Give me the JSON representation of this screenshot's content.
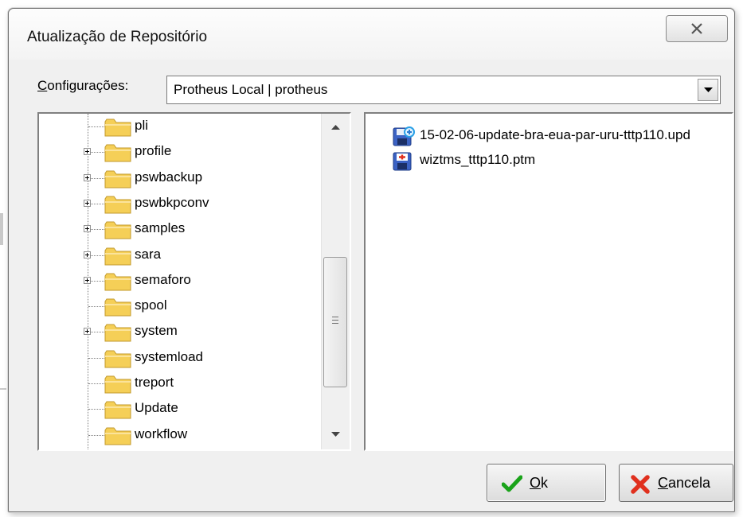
{
  "dialog": {
    "title": "Atualização de Repositório"
  },
  "config": {
    "label_mnemonic": "C",
    "label_rest": "onfigurações:",
    "selected": "Protheus Local | protheus"
  },
  "tree": {
    "items": [
      {
        "label": "pli",
        "expandable": false
      },
      {
        "label": "profile",
        "expandable": true
      },
      {
        "label": "pswbackup",
        "expandable": true
      },
      {
        "label": "pswbkpconv",
        "expandable": true
      },
      {
        "label": "samples",
        "expandable": true
      },
      {
        "label": "sara",
        "expandable": true
      },
      {
        "label": "semaforo",
        "expandable": true
      },
      {
        "label": "spool",
        "expandable": false
      },
      {
        "label": "system",
        "expandable": true
      },
      {
        "label": "systemload",
        "expandable": false
      },
      {
        "label": "treport",
        "expandable": false
      },
      {
        "label": "Update",
        "expandable": false
      },
      {
        "label": "workflow",
        "expandable": false
      }
    ]
  },
  "files": {
    "items": [
      {
        "label": "15-02-06-update-bra-eua-par-uru-tttp110.upd",
        "icon": "patch-file-icon"
      },
      {
        "label": "wiztms_tttp110.ptm",
        "icon": "ptm-file-icon"
      }
    ]
  },
  "buttons": {
    "ok_mnemonic": "O",
    "ok_rest": "k",
    "cancel_mnemonic": "C",
    "cancel_rest": "ancela"
  },
  "colors": {
    "folder": "#f5cf57",
    "ok_check": "#1aa31a",
    "cancel_x": "#e0301e"
  }
}
